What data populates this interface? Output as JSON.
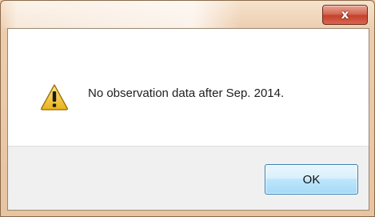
{
  "window": {
    "title": "",
    "close_symbol": "x"
  },
  "dialog": {
    "icon": "warning-icon",
    "message": "No observation data after Sep. 2014.",
    "ok_label": "OK"
  },
  "colors": {
    "frame_tint": "#e9c8a6",
    "close_button": "#c5412b",
    "ok_border": "#3c7fb1",
    "warning_fill": "#f2c530",
    "button_area": "#f0f0f0"
  }
}
